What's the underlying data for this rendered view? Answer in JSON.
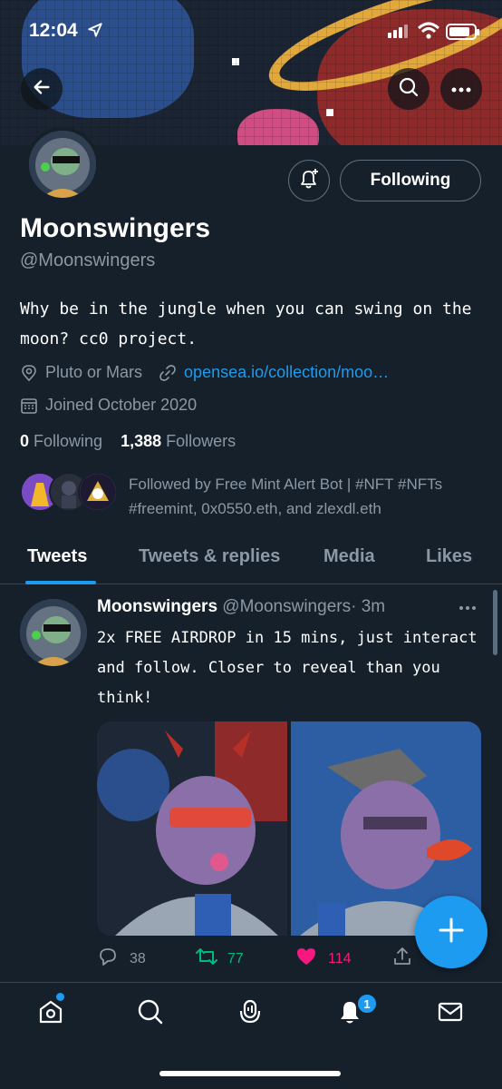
{
  "status_bar": {
    "time": "12:04"
  },
  "profile": {
    "name": "Moonswingers",
    "handle": "@Moonswingers",
    "following_button": "Following",
    "bio": "Why be in the jungle when you can swing on the moon? cc0 project.",
    "location": "Pluto or Mars",
    "website": "opensea.io/collection/moo…",
    "joined": "Joined October 2020",
    "following_count": "0",
    "following_label": "Following",
    "followers_count": "1,388",
    "followers_label": "Followers",
    "followed_by": "Followed by Free Mint Alert Bot | #NFT #NFTs #freemint, 0x0550.eth, and zlexdl.eth"
  },
  "tabs": [
    {
      "label": "Tweets",
      "active": true
    },
    {
      "label": "Tweets & replies",
      "active": false
    },
    {
      "label": "Media",
      "active": false
    },
    {
      "label": "Likes",
      "active": false
    }
  ],
  "tweet": {
    "author_name": "Moonswingers",
    "author_handle": "@Moonswingers",
    "time": "· 3m",
    "text": "2x FREE AIRDROP in 15 mins, just interact and follow. Closer to reveal than you think!",
    "replies": "38",
    "retweets": "77",
    "likes": "114"
  },
  "bottom_nav": {
    "notification_badge": "1"
  },
  "colors": {
    "background": "#15202b",
    "accent": "#1d9bf0",
    "retweet": "#00ba7c",
    "like": "#f91880",
    "muted": "#8b98a5"
  }
}
